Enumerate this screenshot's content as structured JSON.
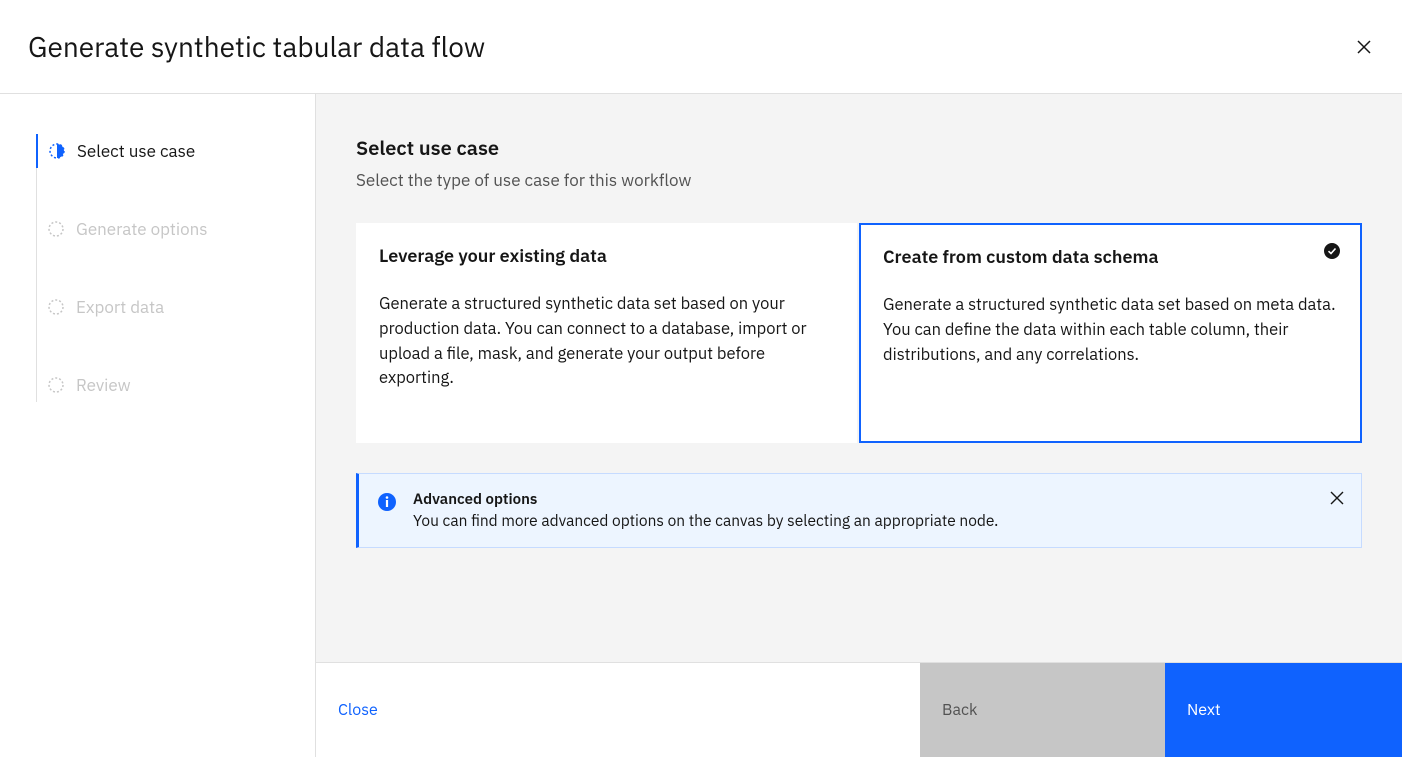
{
  "header": {
    "title": "Generate synthetic tabular data flow"
  },
  "sidebar": {
    "steps": [
      {
        "label": "Select use case"
      },
      {
        "label": "Generate options"
      },
      {
        "label": "Export data"
      },
      {
        "label": "Review"
      }
    ]
  },
  "main": {
    "heading": "Select use case",
    "subtitle": "Select the type of use case for this workflow",
    "cards": {
      "leverage": {
        "title": "Leverage your existing data",
        "description": "Generate a structured synthetic data set based on your production data. You can connect to a database, import or upload a file, mask, and generate your output before exporting."
      },
      "custom": {
        "title": "Create from custom data schema",
        "description": "Generate a structured synthetic data set based on meta data. You can define the data within each table column, their distributions, and any correlations."
      }
    },
    "info": {
      "title": "Advanced options",
      "body": "You can find more advanced options on the canvas by selecting an appropriate node."
    }
  },
  "footer": {
    "close": "Close",
    "back": "Back",
    "next": "Next"
  }
}
